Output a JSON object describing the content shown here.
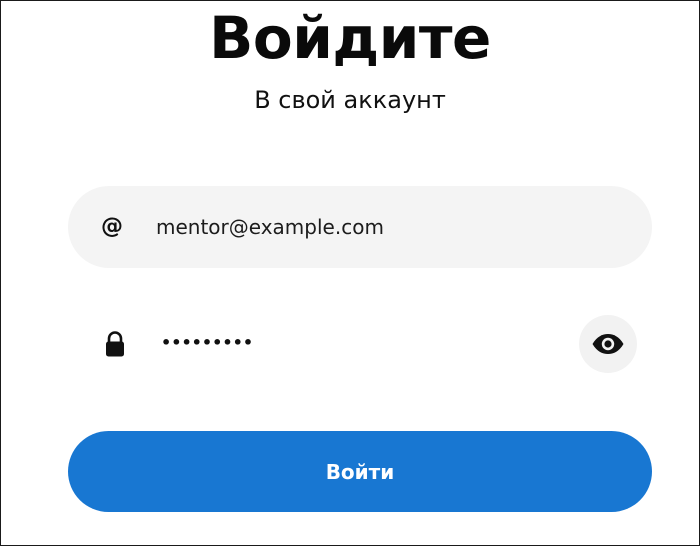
{
  "header": {
    "title": "Войдите",
    "subtitle": "В свой аккаунт"
  },
  "form": {
    "email": {
      "icon": "at-sign-icon",
      "value": "mentor@example.com"
    },
    "password": {
      "icon": "lock-icon",
      "masked_value": "•••••••••",
      "toggle_icon": "eye-icon"
    },
    "submit_label": "Войти"
  },
  "colors": {
    "accent": "#1877d2",
    "field_background": "#f4f4f4",
    "text": "#111111"
  }
}
